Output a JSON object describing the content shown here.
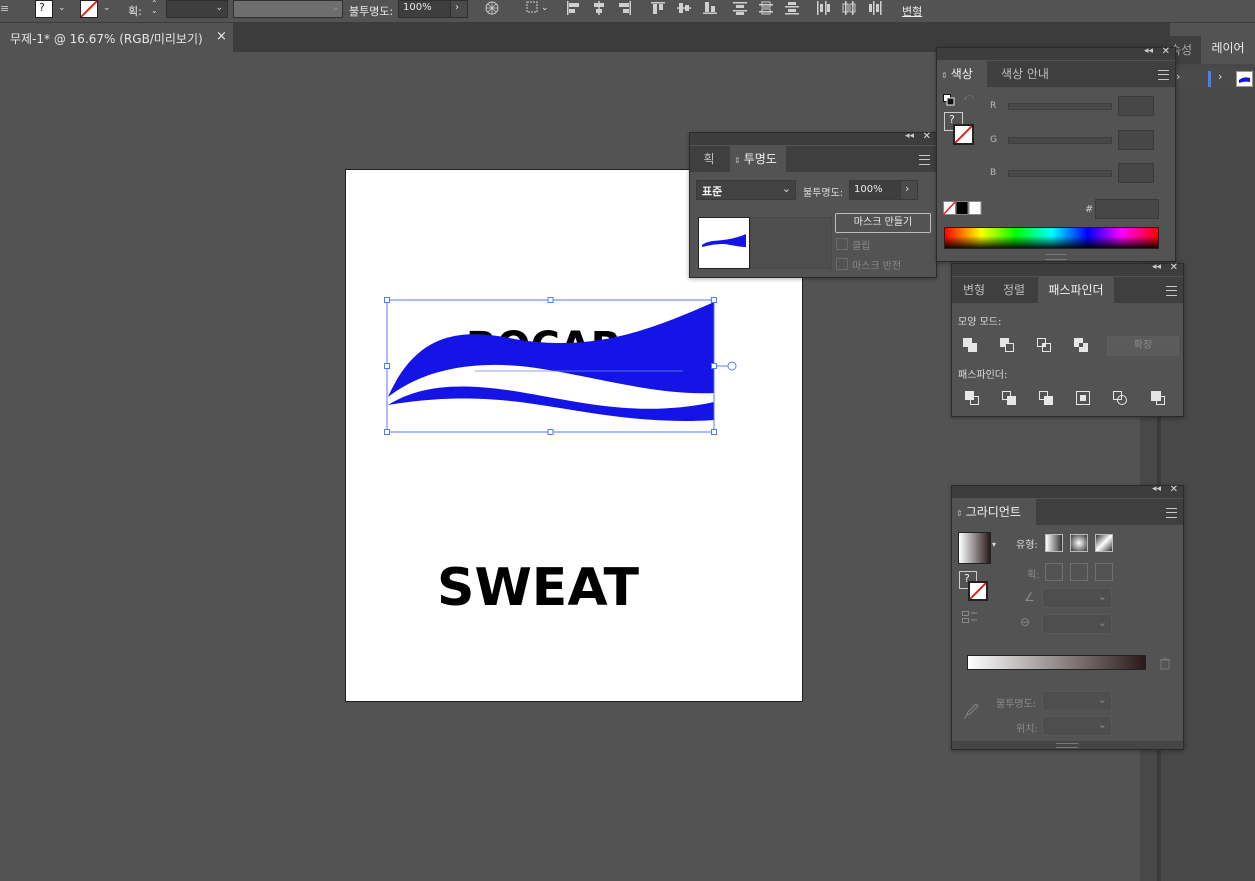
{
  "control_bar": {
    "stroke_label": "획:",
    "opacity_label": "불투명도:",
    "opacity_value": "100%",
    "transform_label": "변형",
    "fill_unknown": "?"
  },
  "document_tab": {
    "title": "무제-1* @ 16.67% (RGB/미리보기)",
    "close": "×"
  },
  "right_dock": {
    "tab_properties": "속성",
    "tab_layers": "레이어"
  },
  "artwork": {
    "headline": "BOCAR",
    "subline": "SWEAT",
    "wave_color": "#1414e6"
  },
  "transparency_panel": {
    "tab_stroke": "획",
    "tab_transparency": "투명도",
    "blend_mode": "표준",
    "opacity_label": "불투명도:",
    "opacity_value": "100%",
    "make_mask_button": "마스크 만들기",
    "clip_label": "클립",
    "invert_mask_label": "마스크 반전"
  },
  "color_panel": {
    "tab_color": "색상",
    "tab_color_guide": "색상 안내",
    "r_label": "R",
    "g_label": "G",
    "b_label": "B",
    "hex_label": "#",
    "unknown": "?"
  },
  "pathfinder_panel": {
    "tab_transform": "변형",
    "tab_align": "정렬",
    "tab_pathfinder": "패스파인더",
    "shape_modes_label": "모양 모드:",
    "expand_button": "확장",
    "pathfinders_label": "패스파인더:"
  },
  "gradient_panel": {
    "tab_gradient": "그라디언트",
    "type_label": "유형:",
    "stroke_label": "획:",
    "opacity_label": "불투명도:",
    "location_label": "위치:",
    "unknown": "?"
  }
}
